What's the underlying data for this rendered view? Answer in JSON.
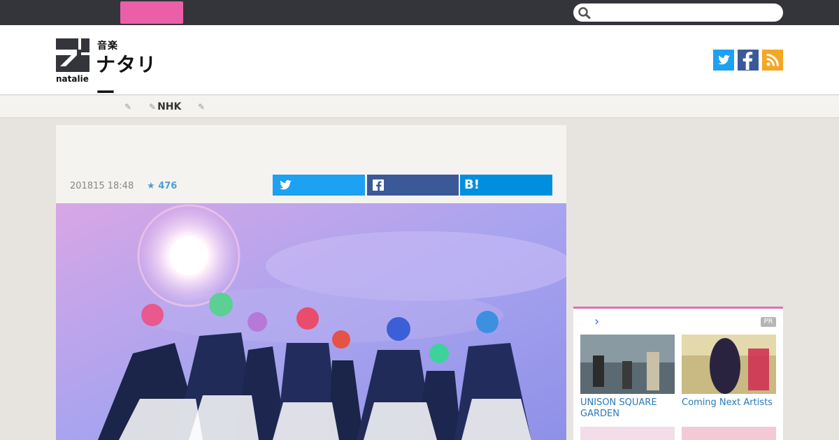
{
  "header": {
    "logo_small": "音楽",
    "logo_big": "ナタリー",
    "logo_en": "natalie"
  },
  "nav": {
    "tags": [
      "",
      "NHK",
      ""
    ]
  },
  "article": {
    "date": "201815 18:48",
    "stars": "476",
    "hatena_label": "B!"
  },
  "sidebar": {
    "arrow": "›",
    "pr_label": "PR",
    "items": [
      {
        "caption": "UNISON SQUARE GARDEN"
      },
      {
        "caption": "Coming Next Artists"
      }
    ]
  },
  "colors": {
    "topbar": "#33353b",
    "accent_pink": "#ea5fa7",
    "twitter": "#1da1f2",
    "facebook": "#3b5998",
    "hatena": "#008fde",
    "rss": "#f5a623",
    "link": "#2a7ab8"
  },
  "icons": [
    "search-icon",
    "twitter-icon",
    "facebook-icon",
    "rss-icon",
    "tag-icon",
    "star-icon",
    "hatena-icon",
    "chevron-right-icon"
  ]
}
